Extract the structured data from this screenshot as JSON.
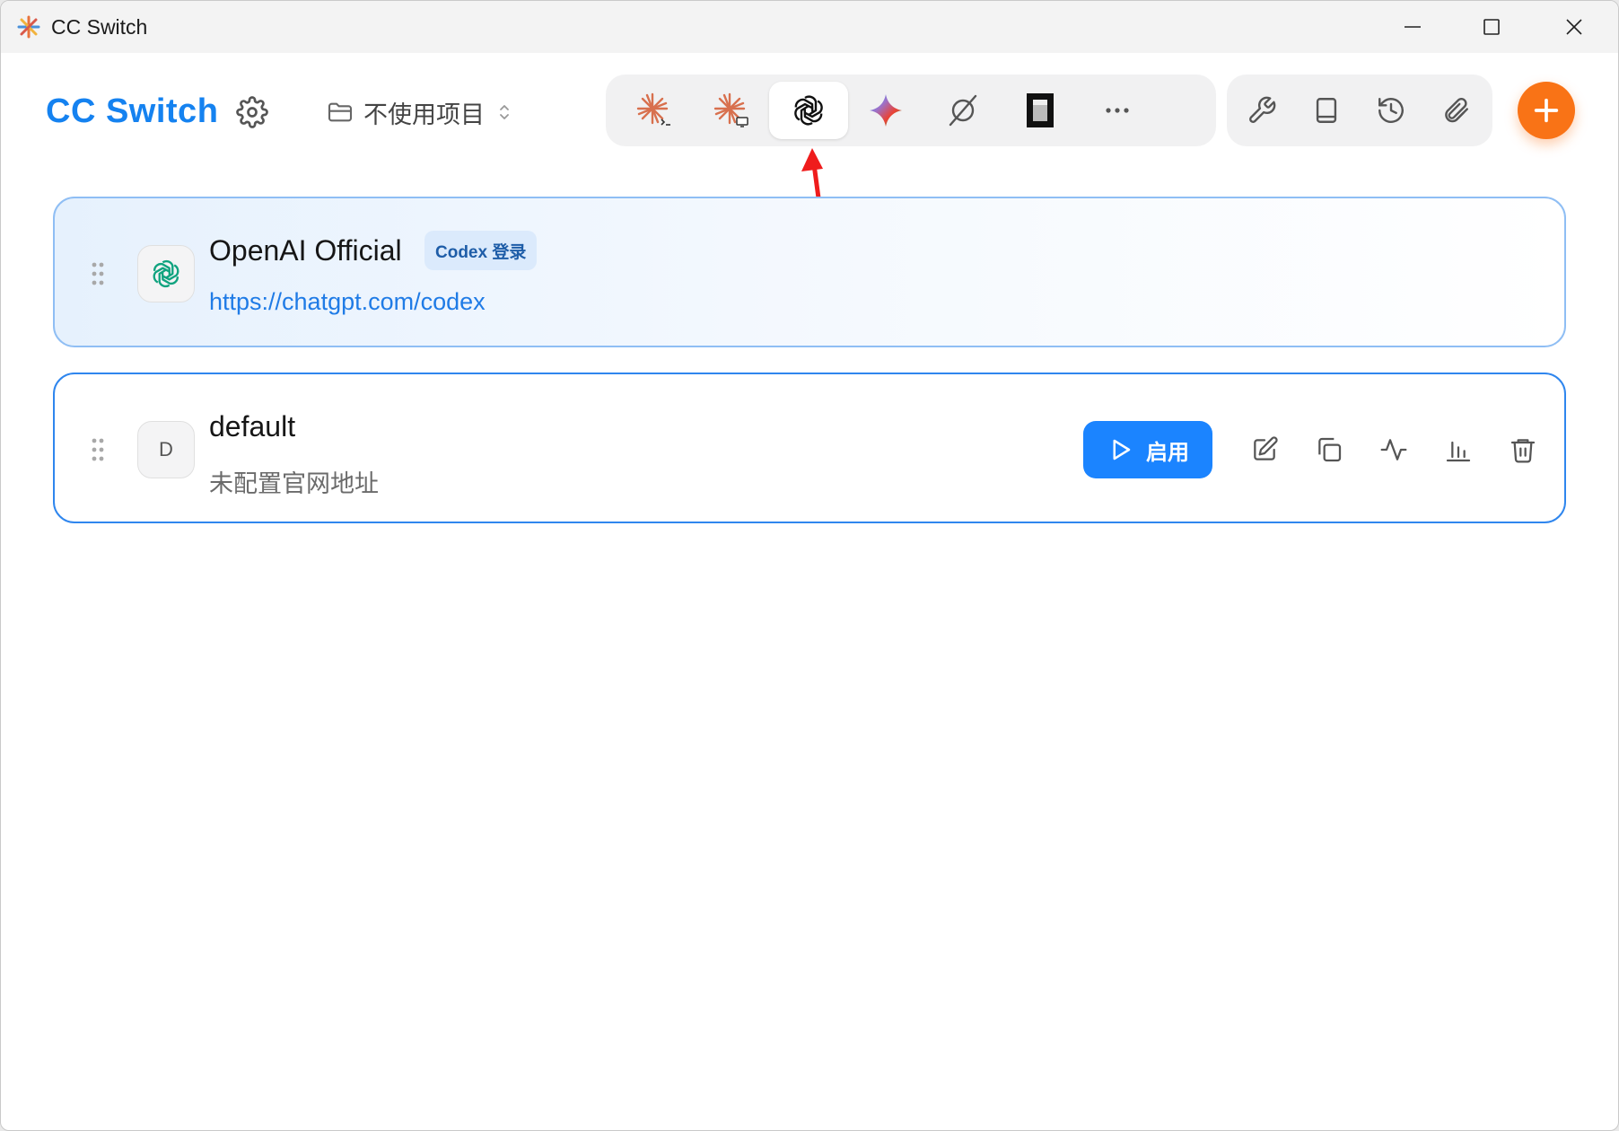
{
  "window": {
    "title": "CC Switch"
  },
  "header": {
    "brand": "CC Switch",
    "project_label": "不使用项目"
  },
  "tabs": [
    {
      "icon": "claude-code-icon",
      "active": false
    },
    {
      "icon": "claude-desktop-icon",
      "active": false
    },
    {
      "icon": "openai-icon",
      "active": true
    },
    {
      "icon": "gemini-icon",
      "active": false
    },
    {
      "icon": "opencode-icon",
      "active": false
    },
    {
      "icon": "terminal-app-icon",
      "active": false
    },
    {
      "icon": "more-icon",
      "active": false
    }
  ],
  "tools": [
    "wrench-icon",
    "book-icon",
    "history-icon",
    "paperclip-icon"
  ],
  "colors": {
    "brand": "#1582f0",
    "accent": "#f97316",
    "primary_button": "#1b84ff",
    "link": "#1f7be6"
  },
  "providers": [
    {
      "name": "OpenAI Official",
      "badge": "Codex 登录",
      "url": "https://chatgpt.com/codex",
      "active": true
    },
    {
      "name": "default",
      "avatar_letter": "D",
      "subtitle": "未配置官网地址",
      "enable_label": "启用",
      "active": false
    }
  ]
}
